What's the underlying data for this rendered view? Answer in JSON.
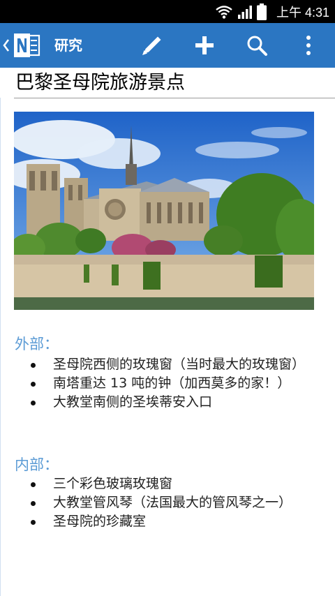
{
  "status_bar": {
    "time": "上午 4:31",
    "icons": [
      "wifi-icon",
      "signal-icon",
      "battery-icon"
    ]
  },
  "app_bar": {
    "back_icon": "chevron-left-icon",
    "logo_icon": "onenote-logo-icon",
    "notebook_title": "研究",
    "actions": [
      "pencil-icon",
      "plus-icon",
      "search-icon",
      "overflow-menu-icon"
    ],
    "background": "#2b76c2"
  },
  "page": {
    "title": "巴黎圣母院旅游景点",
    "image_icon": "notre-dame-photo",
    "sections": [
      {
        "heading": "外部：",
        "items": [
          "圣母院西侧的玫瑰窗（当时最大的玫瑰窗）",
          "南塔重达 13 吨的钟（加西莫多的家！）",
          "大教堂南侧的圣埃蒂安入口"
        ]
      },
      {
        "heading": "内部：",
        "items": [
          "三个彩色玻璃玫瑰窗",
          "大教堂管风琴（法国最大的管风琴之一）",
          "圣母院的珍藏室"
        ]
      }
    ],
    "heading_color": "#5b9bd5"
  }
}
